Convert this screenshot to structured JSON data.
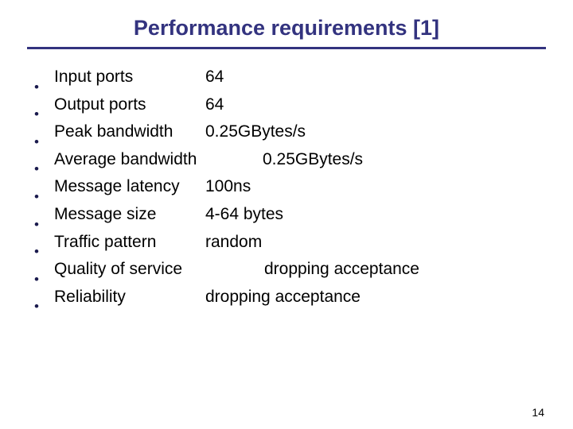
{
  "slide": {
    "title": "Performance requirements [1]",
    "title_color": "#33337f",
    "rule_color": "#33337f",
    "background_color": "#ffffff",
    "text_color": "#000000",
    "bullet_glyph": "•",
    "page_number": "14"
  },
  "bullets": [
    {
      "label": "Input ports",
      "value": "64",
      "value_offset": 190
    },
    {
      "label": "Output ports",
      "value": "64",
      "value_offset": 190
    },
    {
      "label": "Peak bandwidth",
      "value": "0.25GBytes/s",
      "value_offset": 190
    },
    {
      "label": "Average bandwidth",
      "value": "0.25GBytes/s",
      "value_offset": 262
    },
    {
      "label": "Message latency",
      "value": "100ns",
      "value_offset": 190
    },
    {
      "label": "Message size",
      "value": "4-64 bytes",
      "value_offset": 190
    },
    {
      "label": "Traffic pattern",
      "value": "random",
      "value_offset": 190
    },
    {
      "label": "Quality of service",
      "value": "dropping acceptance",
      "value_offset": 264
    },
    {
      "label": "Reliability",
      "value": "dropping acceptance",
      "value_offset": 190
    }
  ]
}
